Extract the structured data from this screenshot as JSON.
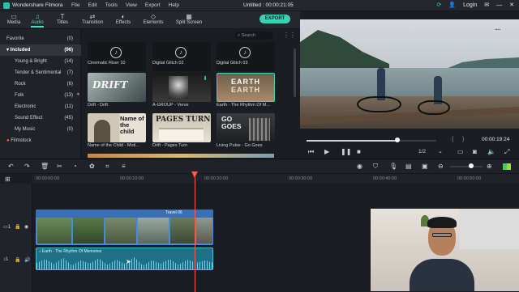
{
  "titlebar": {
    "app_name": "Wondershare Filmora",
    "menu": [
      "File",
      "Edit",
      "Tools",
      "View",
      "Export",
      "Help"
    ],
    "document_title": "Untitled : 00:00:21:05",
    "login": "Login"
  },
  "toolbar": {
    "tabs": [
      {
        "label": "Media",
        "icon": "folder-icon"
      },
      {
        "label": "Audio",
        "icon": "music-note-icon",
        "active": true
      },
      {
        "label": "Titles",
        "icon": "text-icon"
      },
      {
        "label": "Transition",
        "icon": "transition-icon"
      },
      {
        "label": "Effects",
        "icon": "effects-icon"
      },
      {
        "label": "Elements",
        "icon": "elements-icon"
      },
      {
        "label": "Split Screen",
        "icon": "split-screen-icon"
      }
    ],
    "export_label": "EXPORT"
  },
  "library": {
    "favorite": {
      "label": "Favorite",
      "count": "(0)"
    },
    "included": {
      "label": "Included",
      "count": "(96)"
    },
    "categories": [
      {
        "label": "Young & Bright",
        "count": "(14)"
      },
      {
        "label": "Tender & Sentimental",
        "count": "(7)"
      },
      {
        "label": "Rock",
        "count": "(6)"
      },
      {
        "label": "Folk",
        "count": "(13)"
      },
      {
        "label": "Electronic",
        "count": "(11)"
      },
      {
        "label": "Sound Effect",
        "count": "(45)"
      },
      {
        "label": "My Music",
        "count": "(0)"
      }
    ],
    "filmstock": "Filmstock"
  },
  "media": {
    "search_placeholder": "Search",
    "items": [
      {
        "label": "Cinematic Riser 10",
        "thumb_text": ""
      },
      {
        "label": "Digital Glitch 02",
        "thumb_text": ""
      },
      {
        "label": "Digital Glitch 03",
        "thumb_text": ""
      },
      {
        "label": "Drift - Drift",
        "thumb_text": "DRIFT"
      },
      {
        "label": "A-GROUP - Verve",
        "thumb_text": ""
      },
      {
        "label": "Earth - The Rhythm Of M...",
        "thumb_text": "EARTH"
      },
      {
        "label": "Name of the Child - Moti...",
        "thumb_text": "Name of the child"
      },
      {
        "label": "Drift - Pages Turn",
        "thumb_text": "PAGES TURN"
      },
      {
        "label": "Living Pulse - Go Goes",
        "thumb_text": "GO GOES"
      }
    ]
  },
  "player": {
    "timecode": "00:00:19:24",
    "ratio": "1/2",
    "progress": 0.7
  },
  "timeline": {
    "ruler": [
      "00:00:00:00",
      "00:00:10:00",
      "00:00:20:00",
      "00:00:30:00",
      "00:00:40:00",
      "00:00:50:00"
    ],
    "video_clip_label": "Travel 06",
    "audio_clip_label": "Earth - The Rhythm Of Memories"
  },
  "colors": {
    "accent": "#3fcfb4",
    "playhead": "#ff5a4c",
    "video_track": "#4c8ad6",
    "audio_track": "#2f9cb8"
  }
}
